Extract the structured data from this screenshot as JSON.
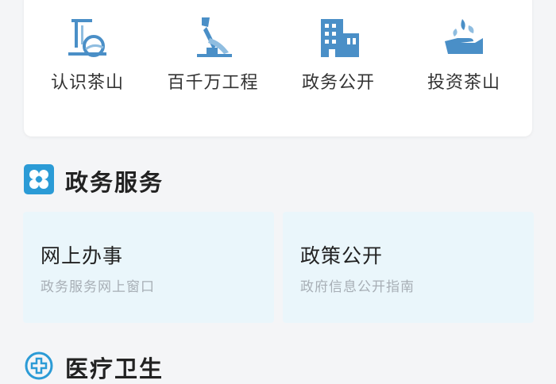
{
  "quick_links": [
    {
      "label": "认识茶山",
      "icon": "landmark-icon"
    },
    {
      "label": "百千万工程",
      "icon": "monument-icon"
    },
    {
      "label": "政务公开",
      "icon": "building-icon"
    },
    {
      "label": "投资茶山",
      "icon": "hand-sprout-icon"
    }
  ],
  "gov_services": {
    "title": "政务服务",
    "icon": "gov-service-icon",
    "cards": [
      {
        "title": "网上办事",
        "subtitle": "政务服务网上窗口"
      },
      {
        "title": "政策公开",
        "subtitle": "政府信息公开指南"
      }
    ]
  },
  "medical": {
    "title": "医疗卫生",
    "icon": "medical-cross-icon"
  },
  "colors": {
    "icon_blue": "#4a8fc7",
    "section_icon": "#2b9bd6",
    "card_bg": "#eaf6fb"
  }
}
